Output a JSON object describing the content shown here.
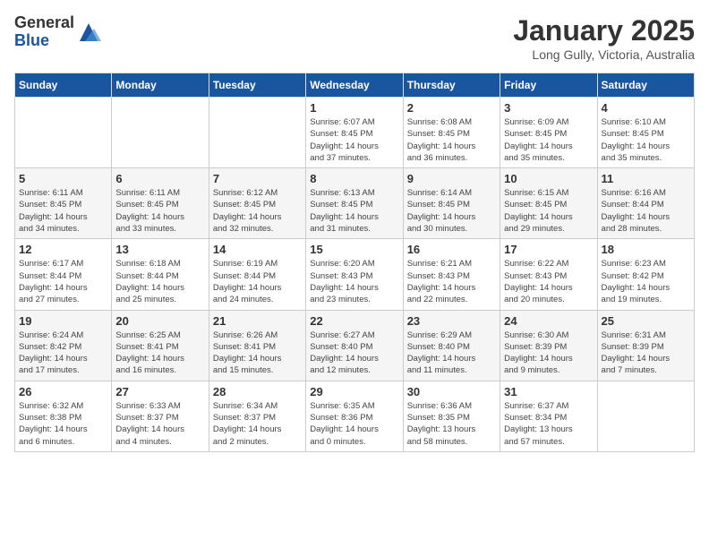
{
  "header": {
    "logo_general": "General",
    "logo_blue": "Blue",
    "month_title": "January 2025",
    "location": "Long Gully, Victoria, Australia"
  },
  "days_of_week": [
    "Sunday",
    "Monday",
    "Tuesday",
    "Wednesday",
    "Thursday",
    "Friday",
    "Saturday"
  ],
  "weeks": [
    [
      {
        "day": "",
        "info": ""
      },
      {
        "day": "",
        "info": ""
      },
      {
        "day": "",
        "info": ""
      },
      {
        "day": "1",
        "info": "Sunrise: 6:07 AM\nSunset: 8:45 PM\nDaylight: 14 hours\nand 37 minutes."
      },
      {
        "day": "2",
        "info": "Sunrise: 6:08 AM\nSunset: 8:45 PM\nDaylight: 14 hours\nand 36 minutes."
      },
      {
        "day": "3",
        "info": "Sunrise: 6:09 AM\nSunset: 8:45 PM\nDaylight: 14 hours\nand 35 minutes."
      },
      {
        "day": "4",
        "info": "Sunrise: 6:10 AM\nSunset: 8:45 PM\nDaylight: 14 hours\nand 35 minutes."
      }
    ],
    [
      {
        "day": "5",
        "info": "Sunrise: 6:11 AM\nSunset: 8:45 PM\nDaylight: 14 hours\nand 34 minutes."
      },
      {
        "day": "6",
        "info": "Sunrise: 6:11 AM\nSunset: 8:45 PM\nDaylight: 14 hours\nand 33 minutes."
      },
      {
        "day": "7",
        "info": "Sunrise: 6:12 AM\nSunset: 8:45 PM\nDaylight: 14 hours\nand 32 minutes."
      },
      {
        "day": "8",
        "info": "Sunrise: 6:13 AM\nSunset: 8:45 PM\nDaylight: 14 hours\nand 31 minutes."
      },
      {
        "day": "9",
        "info": "Sunrise: 6:14 AM\nSunset: 8:45 PM\nDaylight: 14 hours\nand 30 minutes."
      },
      {
        "day": "10",
        "info": "Sunrise: 6:15 AM\nSunset: 8:45 PM\nDaylight: 14 hours\nand 29 minutes."
      },
      {
        "day": "11",
        "info": "Sunrise: 6:16 AM\nSunset: 8:44 PM\nDaylight: 14 hours\nand 28 minutes."
      }
    ],
    [
      {
        "day": "12",
        "info": "Sunrise: 6:17 AM\nSunset: 8:44 PM\nDaylight: 14 hours\nand 27 minutes."
      },
      {
        "day": "13",
        "info": "Sunrise: 6:18 AM\nSunset: 8:44 PM\nDaylight: 14 hours\nand 25 minutes."
      },
      {
        "day": "14",
        "info": "Sunrise: 6:19 AM\nSunset: 8:44 PM\nDaylight: 14 hours\nand 24 minutes."
      },
      {
        "day": "15",
        "info": "Sunrise: 6:20 AM\nSunset: 8:43 PM\nDaylight: 14 hours\nand 23 minutes."
      },
      {
        "day": "16",
        "info": "Sunrise: 6:21 AM\nSunset: 8:43 PM\nDaylight: 14 hours\nand 22 minutes."
      },
      {
        "day": "17",
        "info": "Sunrise: 6:22 AM\nSunset: 8:43 PM\nDaylight: 14 hours\nand 20 minutes."
      },
      {
        "day": "18",
        "info": "Sunrise: 6:23 AM\nSunset: 8:42 PM\nDaylight: 14 hours\nand 19 minutes."
      }
    ],
    [
      {
        "day": "19",
        "info": "Sunrise: 6:24 AM\nSunset: 8:42 PM\nDaylight: 14 hours\nand 17 minutes."
      },
      {
        "day": "20",
        "info": "Sunrise: 6:25 AM\nSunset: 8:41 PM\nDaylight: 14 hours\nand 16 minutes."
      },
      {
        "day": "21",
        "info": "Sunrise: 6:26 AM\nSunset: 8:41 PM\nDaylight: 14 hours\nand 15 minutes."
      },
      {
        "day": "22",
        "info": "Sunrise: 6:27 AM\nSunset: 8:40 PM\nDaylight: 14 hours\nand 12 minutes."
      },
      {
        "day": "23",
        "info": "Sunrise: 6:29 AM\nSunset: 8:40 PM\nDaylight: 14 hours\nand 11 minutes."
      },
      {
        "day": "24",
        "info": "Sunrise: 6:30 AM\nSunset: 8:39 PM\nDaylight: 14 hours\nand 9 minutes."
      },
      {
        "day": "25",
        "info": "Sunrise: 6:31 AM\nSunset: 8:39 PM\nDaylight: 14 hours\nand 7 minutes."
      }
    ],
    [
      {
        "day": "26",
        "info": "Sunrise: 6:32 AM\nSunset: 8:38 PM\nDaylight: 14 hours\nand 6 minutes."
      },
      {
        "day": "27",
        "info": "Sunrise: 6:33 AM\nSunset: 8:37 PM\nDaylight: 14 hours\nand 4 minutes."
      },
      {
        "day": "28",
        "info": "Sunrise: 6:34 AM\nSunset: 8:37 PM\nDaylight: 14 hours\nand 2 minutes."
      },
      {
        "day": "29",
        "info": "Sunrise: 6:35 AM\nSunset: 8:36 PM\nDaylight: 14 hours\nand 0 minutes."
      },
      {
        "day": "30",
        "info": "Sunrise: 6:36 AM\nSunset: 8:35 PM\nDaylight: 13 hours\nand 58 minutes."
      },
      {
        "day": "31",
        "info": "Sunrise: 6:37 AM\nSunset: 8:34 PM\nDaylight: 13 hours\nand 57 minutes."
      },
      {
        "day": "",
        "info": ""
      }
    ]
  ]
}
